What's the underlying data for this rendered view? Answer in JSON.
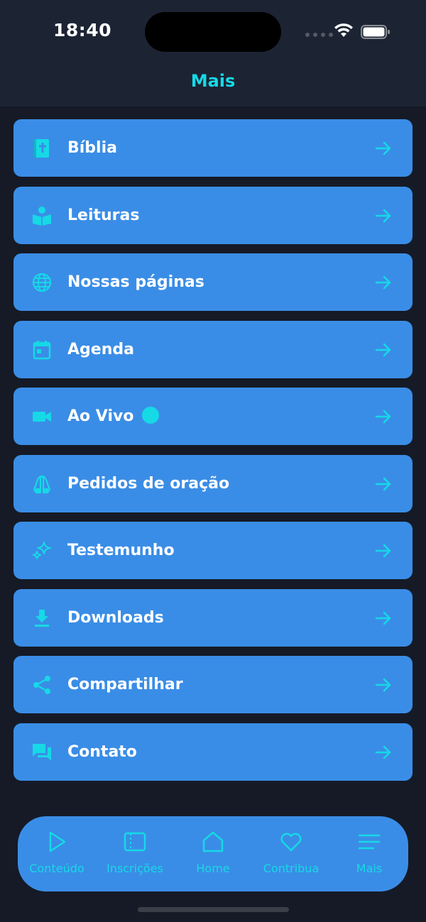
{
  "status_bar": {
    "time": "18:40"
  },
  "header": {
    "title": "Mais"
  },
  "menu": [
    {
      "label": "Bíblia",
      "icon": "bible-icon",
      "name": "bible"
    },
    {
      "label": "Leituras",
      "icon": "reading-icon",
      "name": "readings"
    },
    {
      "label": "Nossas páginas",
      "icon": "globe-icon",
      "name": "our-pages"
    },
    {
      "label": "Agenda",
      "icon": "calendar-icon",
      "name": "agenda"
    },
    {
      "label": "Ao Vivo",
      "icon": "video-camera-icon",
      "name": "live",
      "live_indicator": true
    },
    {
      "label": "Pedidos de oração",
      "icon": "praying-hands-icon",
      "name": "prayer-requests"
    },
    {
      "label": "Testemunho",
      "icon": "sparkles-icon",
      "name": "testimony"
    },
    {
      "label": "Downloads",
      "icon": "download-icon",
      "name": "downloads"
    },
    {
      "label": "Compartilhar",
      "icon": "share-icon",
      "name": "share"
    },
    {
      "label": "Contato",
      "icon": "chat-icon",
      "name": "contact"
    }
  ],
  "tabs": [
    {
      "label": "Conteúdo",
      "icon": "play-icon"
    },
    {
      "label": "Inscrições",
      "icon": "ticket-icon"
    },
    {
      "label": "Home",
      "icon": "home-icon"
    },
    {
      "label": "Contribua",
      "icon": "heart-icon"
    },
    {
      "label": "Mais",
      "icon": "menu-icon"
    }
  ],
  "colors": {
    "background": "#151a26",
    "header": "#1c2434",
    "card": "#3a8de6",
    "accent": "#16d9e6",
    "text": "#ffffff"
  }
}
